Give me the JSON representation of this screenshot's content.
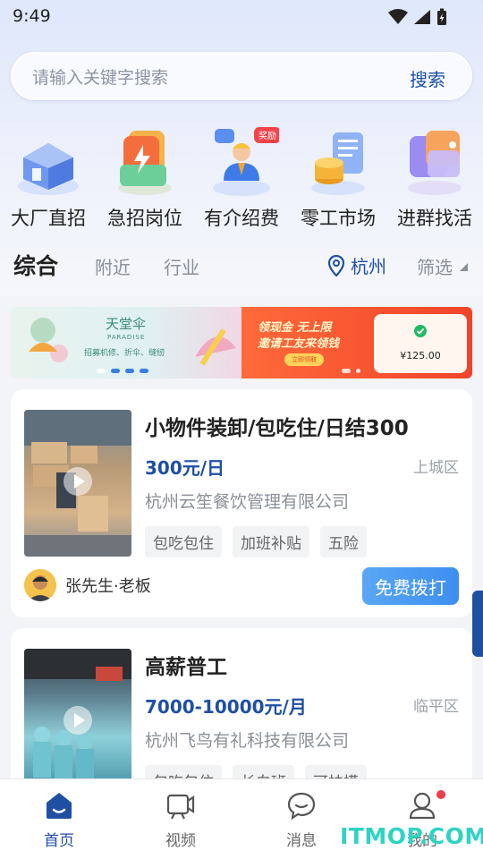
{
  "status_bar": {
    "time": "9:49"
  },
  "search": {
    "placeholder": "请输入关键字搜索",
    "button": "搜索"
  },
  "categories": [
    {
      "label": "大厂直招",
      "icon": "factory-building-icon"
    },
    {
      "label": "急招岗位",
      "icon": "urgent-lightning-icon"
    },
    {
      "label": "有介绍费",
      "icon": "referral-reward-icon",
      "badge": "奖励"
    },
    {
      "label": "零工市场",
      "icon": "coins-document-icon"
    },
    {
      "label": "进群找活",
      "icon": "group-chat-icon"
    }
  ],
  "filters": {
    "tabs": [
      "综合",
      "附近",
      "行业"
    ],
    "active_tab": "综合",
    "location": "杭州",
    "filter": "筛选"
  },
  "banner": {
    "left": {
      "brand": "天堂伞",
      "brand_en": "PARADISE",
      "subtitle": "招募机修、折伞、缝纫"
    },
    "right": {
      "headline_1": "领现金 无上限",
      "headline_2": "邀请工友来领钱",
      "cta": "立即领取",
      "amount": "¥125.00"
    }
  },
  "jobs": [
    {
      "title": "小物件装卸/包吃住/日结300",
      "salary": "300元/日",
      "district": "上城区",
      "company": "杭州云笙餐饮管理有限公司",
      "tags": [
        "包吃包住",
        "加班补贴",
        "五险"
      ],
      "poster": "张先生·老板",
      "call_button": "免费拨打"
    },
    {
      "title": "高薪普工",
      "salary": "7000-10000元/月",
      "district": "临平区",
      "company": "杭州飞鸟有礼科技有限公司",
      "tags": [
        "包吃包住",
        "长白班",
        "可扶摸"
      ]
    }
  ],
  "bottom_nav": [
    {
      "label": "首页",
      "icon": "home-icon",
      "active": true
    },
    {
      "label": "视频",
      "icon": "video-icon"
    },
    {
      "label": "消息",
      "icon": "message-icon"
    },
    {
      "label": "我的",
      "icon": "profile-icon",
      "badge": true
    }
  ],
  "watermark": "ITMOP.COM",
  "colors": {
    "brand_blue": "#1f4fa3",
    "call_button": "#3d8ef0",
    "badge_red": "#f03c4b",
    "watermark": "#2fd3c4"
  }
}
